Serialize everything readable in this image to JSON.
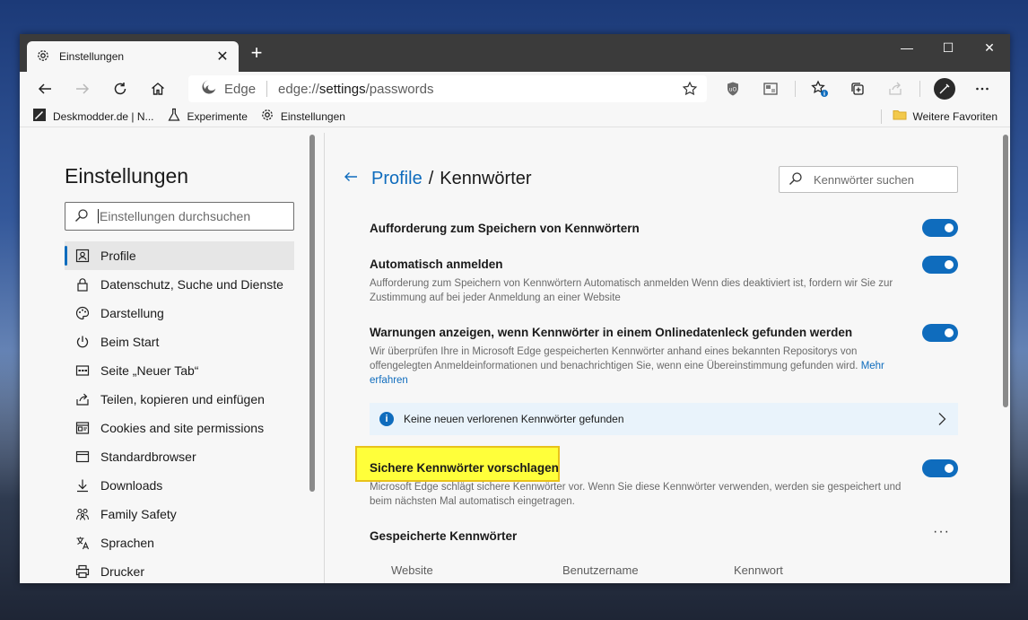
{
  "tab": {
    "title": "Einstellungen",
    "close": "✕",
    "new": "+"
  },
  "window_controls": {
    "minimize": "—",
    "maximize": "☐",
    "close": "✕"
  },
  "address": {
    "brand": "Edge",
    "scheme": "edge://",
    "host": "settings",
    "path": "/passwords"
  },
  "bookmarks": {
    "items": [
      {
        "label": "Deskmodder.de | N..."
      },
      {
        "label": "Experimente"
      },
      {
        "label": "Einstellungen"
      }
    ],
    "other": "Weitere Favoriten"
  },
  "sidebar": {
    "title": "Einstellungen",
    "search_placeholder": "Einstellungen durchsuchen",
    "items": [
      {
        "label": "Profile",
        "icon": "profile-icon",
        "active": true
      },
      {
        "label": "Datenschutz, Suche und Dienste",
        "icon": "lock-icon"
      },
      {
        "label": "Darstellung",
        "icon": "palette-icon"
      },
      {
        "label": "Beim Start",
        "icon": "power-icon"
      },
      {
        "label": "Seite „Neuer Tab“",
        "icon": "newtab-icon"
      },
      {
        "label": "Teilen, kopieren und einfügen",
        "icon": "share-icon"
      },
      {
        "label": "Cookies and site permissions",
        "icon": "cookies-icon"
      },
      {
        "label": "Standardbrowser",
        "icon": "browser-icon"
      },
      {
        "label": "Downloads",
        "icon": "download-icon"
      },
      {
        "label": "Family Safety",
        "icon": "family-icon"
      },
      {
        "label": "Sprachen",
        "icon": "language-icon"
      },
      {
        "label": "Drucker",
        "icon": "printer-icon"
      }
    ]
  },
  "main": {
    "breadcrumb_parent": "Profile",
    "breadcrumb_sep": "/",
    "breadcrumb_current": "Kennwörter",
    "search_placeholder": "Kennwörter suchen",
    "settings": [
      {
        "title": "Aufforderung zum Speichern von Kennwörtern",
        "enabled": true
      },
      {
        "title": "Automatisch anmelden",
        "desc": "Aufforderung zum Speichern von Kennwörtern Automatisch anmelden Wenn dies deaktiviert ist, fordern wir Sie zur Zustimmung auf bei jeder Anmeldung an einer Website",
        "enabled": true
      },
      {
        "title": "Warnungen anzeigen, wenn Kennwörter in einem Onlinedatenleck gefunden werden",
        "desc": "Wir überprüfen Ihre in Microsoft Edge gespeicherten Kennwörter anhand eines bekannten Repositorys von offengelegten Anmeldeinformationen und benachrichtigen Sie, wenn eine Übereinstimmung gefunden wird.",
        "link": "Mehr erfahren",
        "enabled": true
      },
      {
        "title": "Sichere Kennwörter vorschlagen",
        "desc": "Microsoft Edge schlägt sichere Kennwörter vor. Wenn Sie diese Kennwörter verwenden, werden sie gespeichert und beim nächsten Mal automatisch eingetragen.",
        "enabled": true
      }
    ],
    "info": "Keine neuen verlorenen Kennwörter gefunden",
    "saved_title": "Gespeicherte Kennwörter",
    "more": "···",
    "columns": [
      "Website",
      "Benutzername",
      "Kennwort"
    ]
  },
  "colors": {
    "accent": "#0f6cbd",
    "highlight": "#ffff3a"
  }
}
